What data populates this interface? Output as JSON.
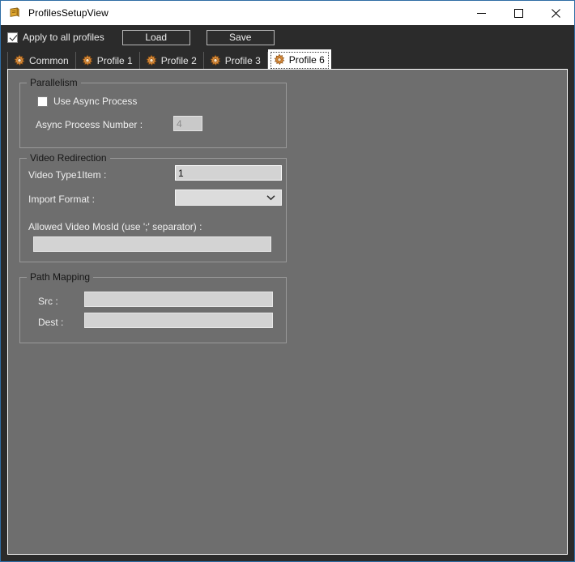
{
  "window": {
    "title": "ProfilesSetupView",
    "app_icon": "profile-document-icon",
    "minimize_label": "—",
    "maximize_label": "□",
    "close_label": "✕"
  },
  "toolbar": {
    "apply_all_label": "Apply to all profiles",
    "apply_all_checked": true,
    "load_label": "Load",
    "save_label": "Save"
  },
  "tabs": [
    {
      "label": "Common",
      "icon": "gear-icon",
      "selected": false
    },
    {
      "label": "Profile 1",
      "icon": "gear-icon",
      "selected": false
    },
    {
      "label": "Profile 2",
      "icon": "gear-icon",
      "selected": false
    },
    {
      "label": "Profile 3",
      "icon": "gear-icon",
      "selected": false
    },
    {
      "label": "Profile 6",
      "icon": "gear-icon",
      "selected": true
    }
  ],
  "groups": {
    "parallelism": {
      "title": "Parallelism",
      "use_async_label": "Use Async Process",
      "use_async_checked": false,
      "async_number_label": "Async Process Number :",
      "async_number_value": "4",
      "async_number_enabled": false
    },
    "video_redirection": {
      "title": "Video Redirection",
      "video_type_label": "Video Type1Item :",
      "video_type_value": "1",
      "import_format_label": "Import Format :",
      "import_format_value": "",
      "allowed_mosid_label": "Allowed Video MosId (use ';' separator) :",
      "allowed_mosid_value": ""
    },
    "path_mapping": {
      "title": "Path Mapping",
      "src_label": "Src :",
      "src_value": "",
      "dest_label": "Dest :",
      "dest_value": ""
    }
  },
  "colors": {
    "window_border": "#2e6da4",
    "titlebar_bg": "#ffffff",
    "chrome_bg": "#2b2b2b",
    "panel_bg": "#6e6e6e",
    "label_text": "#efefef",
    "group_title_text": "#161616",
    "field_bg": "#d3d3d3",
    "tab_icon": "#d88a3a"
  }
}
